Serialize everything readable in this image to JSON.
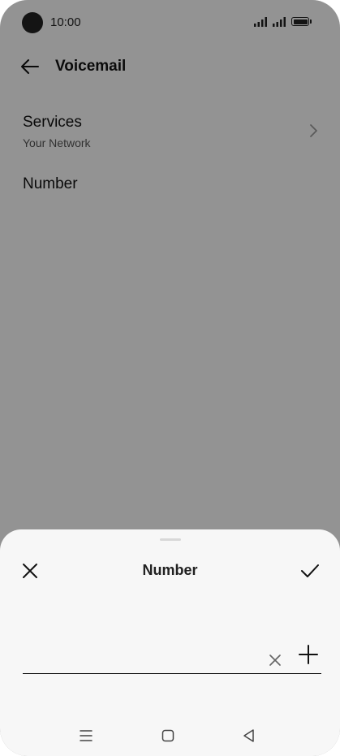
{
  "status_bar": {
    "time": "10:00"
  },
  "app_bar": {
    "title": "Voicemail"
  },
  "settings": {
    "services": {
      "title": "Services",
      "subtitle": "Your Network"
    },
    "number": {
      "title": "Number"
    }
  },
  "sheet": {
    "title": "Number",
    "input": {
      "value": "",
      "placeholder": ""
    }
  },
  "icons": {
    "back": "back-arrow-icon",
    "chevron": "chevron-right-icon",
    "close": "close-icon",
    "confirm": "check-icon",
    "clear": "clear-icon",
    "add": "plus-icon",
    "nav_menu": "menu-icon",
    "nav_home": "home-icon",
    "nav_back": "back-triangle-icon"
  },
  "colors": {
    "scrim": "#696969",
    "sheet": "#f7f7f7",
    "text": "#111111"
  }
}
